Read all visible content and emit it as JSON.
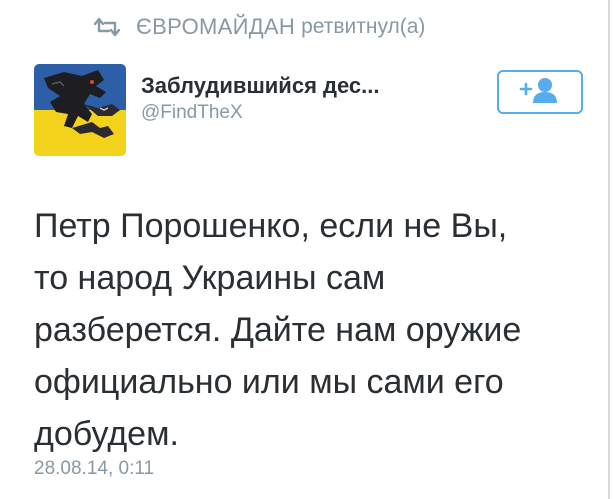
{
  "retweet": {
    "icon": "retweet-icon",
    "user": "ЄВРОМАЙДАН",
    "action": "ретвитнул(а)"
  },
  "author": {
    "display_name": "Заблудившийся дес...",
    "handle": "@FindTheX",
    "avatar": "dragon-avatar-ukrainian-flag"
  },
  "follow_button": {
    "icon": "add-user-icon",
    "accent": "#55acee"
  },
  "tweet": {
    "text": "Петр Порошенко, если не Вы,\nто народ Украины сам\nразберется. Дайте нам оружие\nофициально или мы сами его\nдобудем.",
    "timestamp": "28.08.14, 0:11"
  },
  "colors": {
    "text": "#292f33",
    "muted": "#8899a6",
    "flag_blue": "#2c5fa8",
    "flag_yellow": "#f2d21a"
  }
}
